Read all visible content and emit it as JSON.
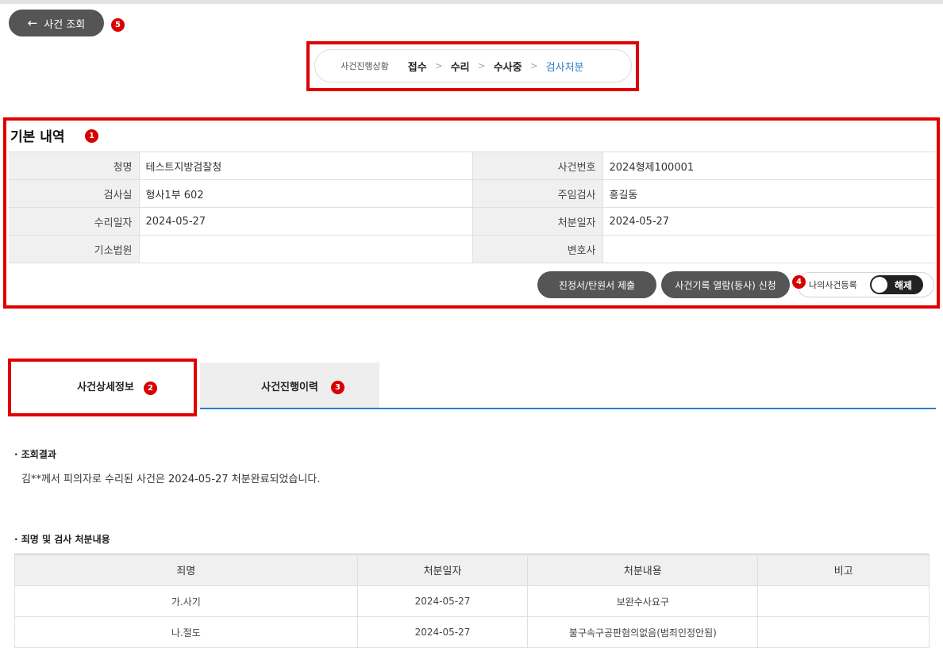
{
  "back_button": {
    "label": "사건 조회"
  },
  "markers": [
    "1",
    "2",
    "3",
    "4",
    "5"
  ],
  "progress": {
    "label": "사건진행상황",
    "steps": [
      "접수",
      "수리",
      "수사중",
      "검사처분"
    ],
    "separator": ">"
  },
  "basic_info": {
    "title": "기본 내역",
    "rows": [
      {
        "label1": "청명",
        "value1": "테스트지방검찰청",
        "label2": "사건번호",
        "value2": "2024형제100001"
      },
      {
        "label1": "검사실",
        "value1": "형사1부 602",
        "label2": "주임검사",
        "value2": "홍길동"
      },
      {
        "label1": "수리일자",
        "value1": "2024-05-27",
        "label2": "처분일자",
        "value2": "2024-05-27"
      },
      {
        "label1": "기소법원",
        "value1": "",
        "label2": "변호사",
        "value2": ""
      }
    ],
    "petition_button": "진정서/탄원서 제출",
    "record_button": "사건기록 열람(등사) 신청",
    "my_case_label": "나의사건등록",
    "toggle_label": "해제"
  },
  "tabs": [
    {
      "label": "사건상세정보"
    },
    {
      "label": "사건진행이력"
    }
  ],
  "result": {
    "title": "조회결과",
    "text": "김**께서 피의자로 수리된 사건은 2024-05-27 처분완료되었습니다."
  },
  "charges": {
    "title": "죄명 및 검사 처분내용",
    "headers": [
      "죄명",
      "처분일자",
      "처분내용",
      "비고"
    ],
    "rows": [
      [
        "가.사기",
        "2024-05-27",
        "보완수사요구",
        ""
      ],
      [
        "나.절도",
        "2024-05-27",
        "불구속구공판혐의없음(범죄인정안됨)",
        ""
      ]
    ]
  },
  "colors": {
    "marker": "#d60000",
    "highlight_box": "#e00000",
    "accent": "#2a7fc9",
    "button_dark": "#555555"
  }
}
